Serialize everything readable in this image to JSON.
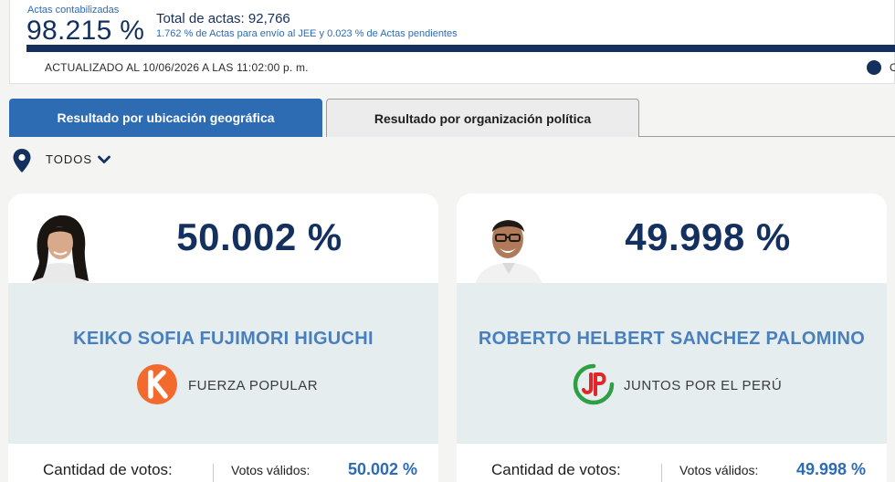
{
  "summary": {
    "actas_label": "Actas contabilizadas",
    "actas_pct": "98.215 %",
    "total_actas": "Total de actas: 92,766",
    "subtext": "1.762 % de Actas para envío al JEE y 0.023 % de Actas pendientes",
    "progress_fraction": 0.98215,
    "updated": "ACTUALIZADO AL 10/06/2026 A LAS 11:02:00 p. m.",
    "legend_text": "C"
  },
  "tabs": [
    {
      "label": "Resultado por ubicación geográfica",
      "active": true
    },
    {
      "label": "Resultado por organización política",
      "active": false
    }
  ],
  "filter": {
    "label": "TODOS"
  },
  "candidates": [
    {
      "percent": "50.002 %",
      "name": "KEIKO SOFIA FUJIMORI HIGUCHI",
      "party": "FUERZA POPULAR",
      "party_logo_color": "#f26a2e",
      "votes_label": "Cantidad de votos:",
      "valid_label": "Votos válidos:",
      "valid_pct": "50.002 %"
    },
    {
      "percent": "49.998 %",
      "name": "ROBERTO HELBERT SANCHEZ PALOMINO",
      "party": "JUNTOS POR EL PERÚ",
      "party_logo_color": "#2ea043",
      "party_logo_accent": "#e0262b",
      "votes_label": "Cantidad de votos:",
      "valid_label": "Votos válidos:",
      "valid_pct": "49.998 %"
    }
  ],
  "colors": {
    "navy": "#14305e",
    "accent_blue": "#2d6bb3",
    "panel": "#e5edef"
  }
}
